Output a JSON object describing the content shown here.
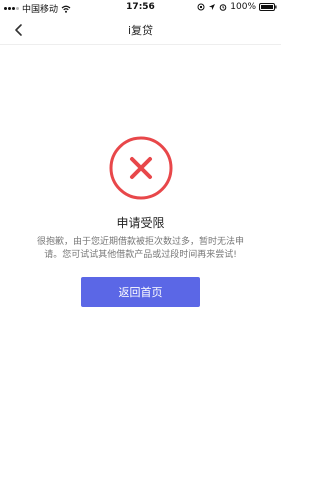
{
  "status_bar": {
    "carrier": "中国移动",
    "time": "17:56",
    "battery": "100%"
  },
  "nav": {
    "title": "i复贷",
    "back_icon": "chevron-left-icon"
  },
  "result": {
    "icon": "error-x-icon",
    "icon_color": "#e8474a",
    "title": "申请受限",
    "description": "很抱歉，由于您近期借款被拒次数过多，暂时无法申请。您可试试其他借款产品或过段时间再来尝试!",
    "button_label": "返回首页"
  },
  "colors": {
    "accent": "#5b67e6",
    "error": "#e8474a"
  }
}
